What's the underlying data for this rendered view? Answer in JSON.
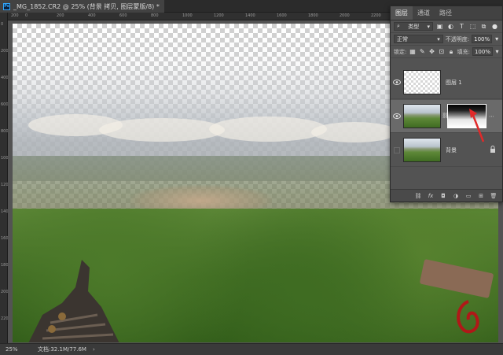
{
  "document": {
    "tab_title": "_MG_1852.CR2 @ 25% (背景 拷贝, 图层蒙版/8) *",
    "app_badge": "Ps"
  },
  "rulers": {
    "top_ticks": [
      "200",
      "0",
      "200",
      "400",
      "600",
      "800",
      "1000",
      "1200",
      "1400",
      "1600",
      "1800",
      "2000",
      "2200",
      "2400"
    ],
    "left_ticks": [
      "0",
      "200",
      "400",
      "600",
      "800",
      "1000",
      "1200",
      "1400",
      "1600",
      "1800",
      "2000",
      "2200"
    ]
  },
  "layers_panel": {
    "tabs": [
      "图层",
      "通道",
      "路径"
    ],
    "active_tab": "图层",
    "filter_kind": "类型",
    "blend_mode": "正常",
    "opacity_label": "不透明度:",
    "opacity_value": "100%",
    "lock_label": "锁定:",
    "fill_label": "填充:",
    "fill_value": "100%",
    "layers": [
      {
        "name": "图层 1",
        "visible": true,
        "selected": false
      },
      {
        "name": "",
        "visible": true,
        "selected": true,
        "has_mask": true
      },
      {
        "name": "背景",
        "visible": false,
        "selected": false,
        "locked": true
      }
    ],
    "bottom_icons": [
      "link-icon",
      "fx-icon",
      "mask-icon",
      "adjustment-icon",
      "group-icon",
      "new-layer-icon",
      "delete-icon"
    ],
    "fx_label": "fx"
  },
  "status_bar": {
    "zoom": "25%",
    "doc_info": "文档:32.1M/77.6M"
  },
  "colors": {
    "accent_arrow": "#e02a2a",
    "panel_bg": "#535353",
    "app_bg": "#3a3a3a"
  }
}
